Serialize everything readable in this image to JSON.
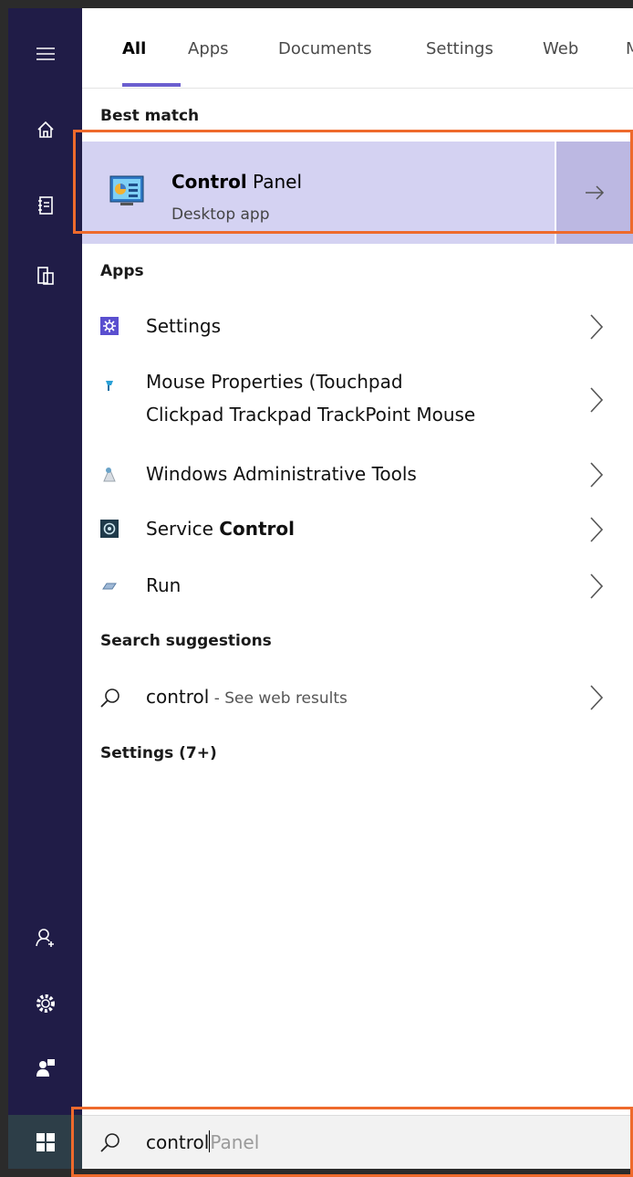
{
  "tabs": [
    "All",
    "Apps",
    "Documents",
    "Settings",
    "Web",
    "M"
  ],
  "best_match": {
    "section": "Best match",
    "title_bold": "Control",
    "title_rest": " Panel",
    "subtitle": "Desktop app"
  },
  "apps": {
    "section": "Apps",
    "settings": "Settings",
    "mouse_line1": "Mouse Properties (Touchpad",
    "mouse_line2": "Clickpad Trackpad TrackPoint Mouse",
    "admin_tools": "Windows Administrative Tools",
    "service_plain": "Service ",
    "service_bold": "Control",
    "run": "Run"
  },
  "suggestions": {
    "section": "Search suggestions",
    "query": "control",
    "hint": " - See web results"
  },
  "settings_count": "Settings (7+)",
  "search": {
    "typed": "control",
    "autocomplete": "Panel"
  },
  "colors": {
    "rail": "#201c47",
    "selection": "#d4d2f2",
    "accent": "#6b5fcf",
    "highlight": "#ee6a2c"
  },
  "rail_icons": [
    "hamburger-icon",
    "home-icon",
    "documents-icon",
    "devices-icon",
    "add-user-icon",
    "gear-icon",
    "feedback-icon",
    "windows-logo-icon"
  ]
}
